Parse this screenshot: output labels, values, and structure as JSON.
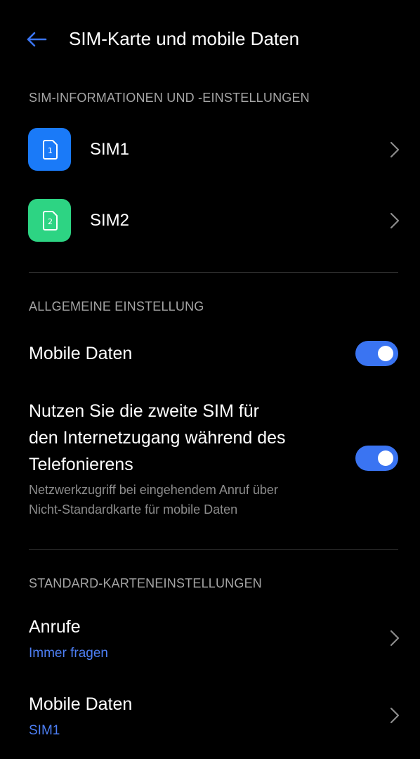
{
  "header": {
    "title": "SIM-Karte und mobile Daten",
    "back_icon": "arrow-left-icon"
  },
  "colors": {
    "background": "#000000",
    "accent": "#3a74f2",
    "link": "#4d7ff5",
    "sim1": "#1a7af8",
    "sim2": "#2dd483",
    "section_header": "#a6a6a6",
    "divider": "#333333"
  },
  "sections": {
    "sim_info": {
      "header": "SIM-INFORMATIONEN UND -EINSTELLUNGEN",
      "items": [
        {
          "label": "SIM1",
          "icon_number": "1",
          "icon": "sim-card-icon"
        },
        {
          "label": "SIM2",
          "icon_number": "2",
          "icon": "sim-card-icon"
        }
      ]
    },
    "general": {
      "header": "ALLGEMEINE EINSTELLUNG",
      "mobile_data": {
        "label": "Mobile Daten",
        "enabled": true
      },
      "second_sim": {
        "title_lines": [
          "Nutzen Sie die zweite SIM für",
          "den Internetzugang während des",
          "Telefonierens"
        ],
        "subtitle_lines": [
          "Netzwerkzugriff bei eingehendem Anruf über",
          "Nicht-Standardkarte für mobile Daten"
        ],
        "enabled": true
      }
    },
    "default_card": {
      "header": "STANDARD-KARTENEINSTELLUNGEN",
      "items": [
        {
          "label": "Anrufe",
          "value": "Immer fragen"
        },
        {
          "label": "Mobile Daten",
          "value": "SIM1"
        }
      ]
    }
  }
}
